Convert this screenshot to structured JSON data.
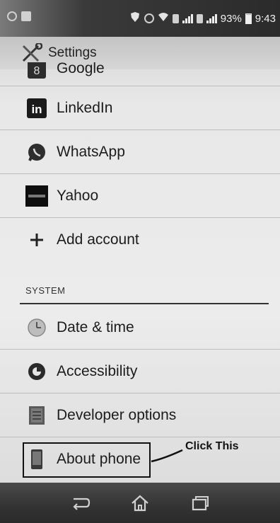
{
  "status_bar": {
    "battery_percent": "93%",
    "time": "9:43"
  },
  "action_bar": {
    "title": "Settings"
  },
  "accounts": [
    {
      "label": "Google",
      "icon": "google-icon"
    },
    {
      "label": "LinkedIn",
      "icon": "linkedin-icon"
    },
    {
      "label": "WhatsApp",
      "icon": "whatsapp-icon"
    },
    {
      "label": "Yahoo",
      "icon": "yahoo-icon"
    },
    {
      "label": "Add account",
      "icon": "plus-icon"
    }
  ],
  "system": {
    "header": "SYSTEM",
    "items": [
      {
        "label": "Date & time",
        "icon": "clock-icon"
      },
      {
        "label": "Accessibility",
        "icon": "accessibility-icon"
      },
      {
        "label": "Developer options",
        "icon": "developer-icon"
      },
      {
        "label": "About phone",
        "icon": "phone-icon"
      }
    ]
  },
  "annotation": {
    "callout": "Click This"
  },
  "nav_bar": {
    "buttons": [
      "back-icon",
      "home-icon",
      "recents-icon"
    ]
  }
}
